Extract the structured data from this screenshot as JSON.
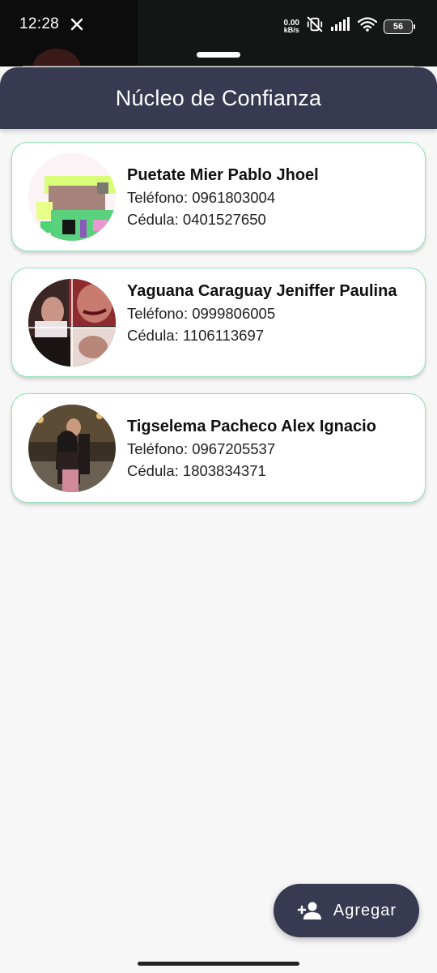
{
  "status_bar": {
    "time": "12:28",
    "net_speed_value": "0.00",
    "net_speed_unit": "kB/s",
    "battery": "56"
  },
  "header": {
    "title": "Núcleo de Confianza"
  },
  "contacts": [
    {
      "name": "Puetate Mier Pablo Jhoel",
      "phone": "Teléfono: 0961803004",
      "id": "Cédula: 0401527650"
    },
    {
      "name": "Yaguana Caraguay Jeniffer Paulina",
      "phone": "Teléfono: 0999806005",
      "id": "Cédula: 1106113697"
    },
    {
      "name": "Tigselema Pacheco Alex Ignacio",
      "phone": "Teléfono: 0967205537",
      "id": "Cédula: 1803834371"
    }
  ],
  "fab": {
    "label": "Agregar",
    "icon": "person-add-icon"
  },
  "colors": {
    "primary": "#373a50",
    "card_border": "#8fe3b4",
    "background": "#f7f7f7"
  }
}
